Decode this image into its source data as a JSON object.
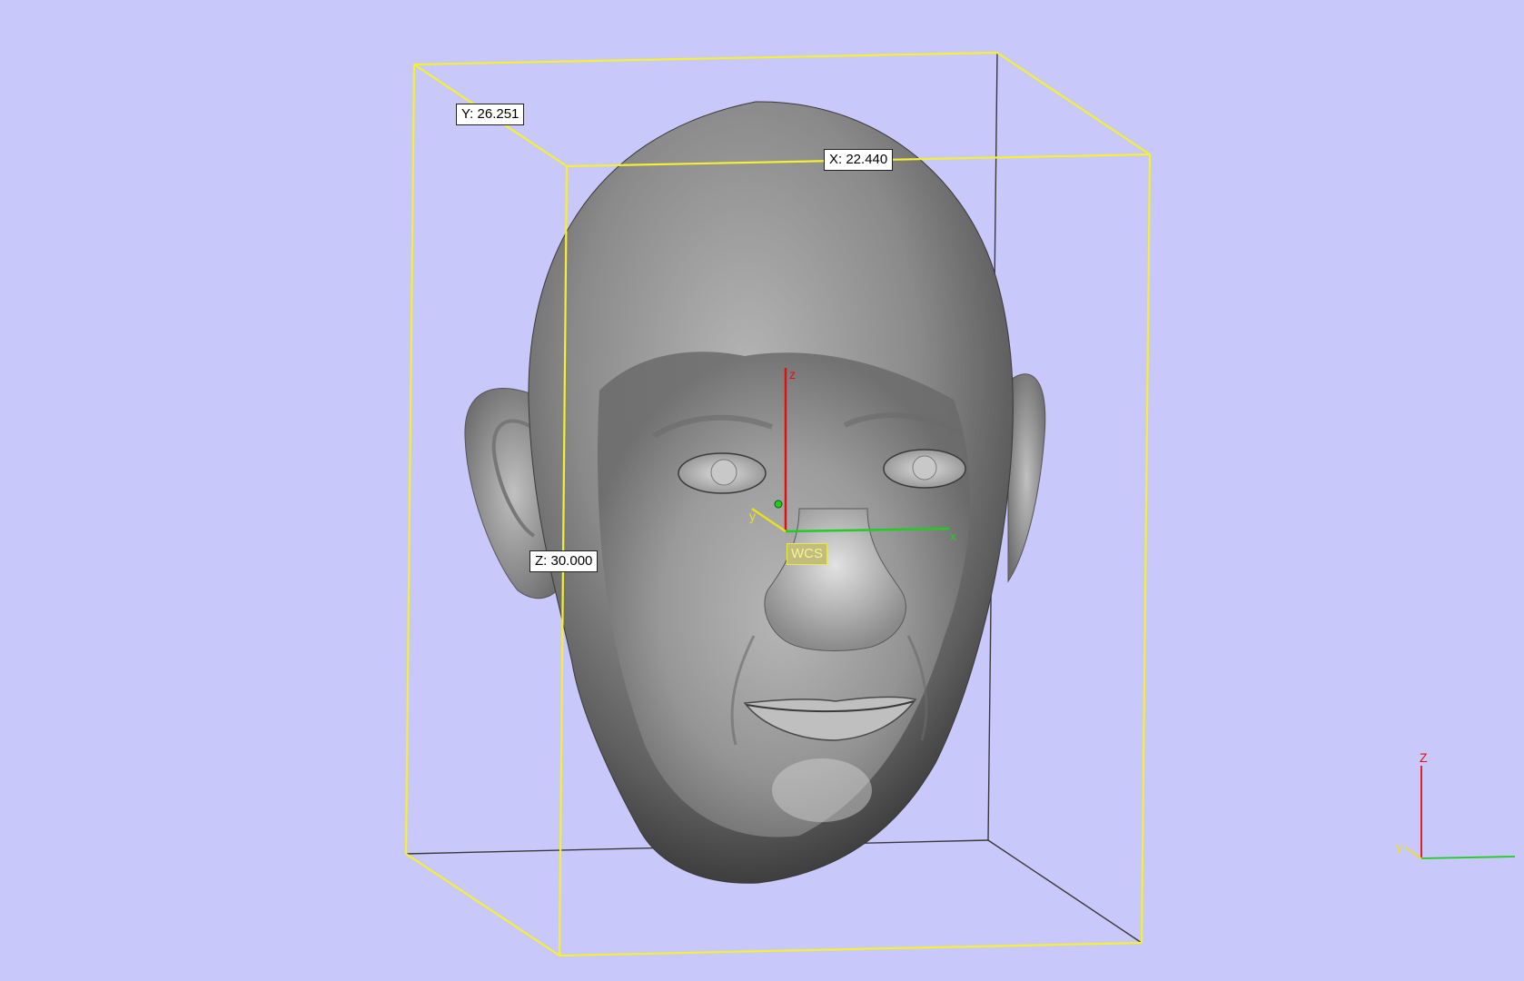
{
  "viewport": {
    "background_color": "#c8c8fa",
    "bounding_box_color": "#f5f032"
  },
  "dimensions": {
    "x_label": "X: 22.440",
    "y_label": "Y: 26.251",
    "z_label": "Z: 30.000"
  },
  "wcs": {
    "label": "WCS",
    "axes": {
      "x": "x",
      "y": "y",
      "z": "z"
    },
    "colors": {
      "x": "#22cc22",
      "y": "#e8e020",
      "z": "#e01010"
    }
  },
  "orientation_gizmo": {
    "x": "",
    "y": "Y",
    "z": "Z",
    "colors": {
      "x": "#22cc22",
      "y": "#e8e020",
      "z": "#e01010"
    }
  },
  "model": {
    "icon": "head-model-icon"
  }
}
